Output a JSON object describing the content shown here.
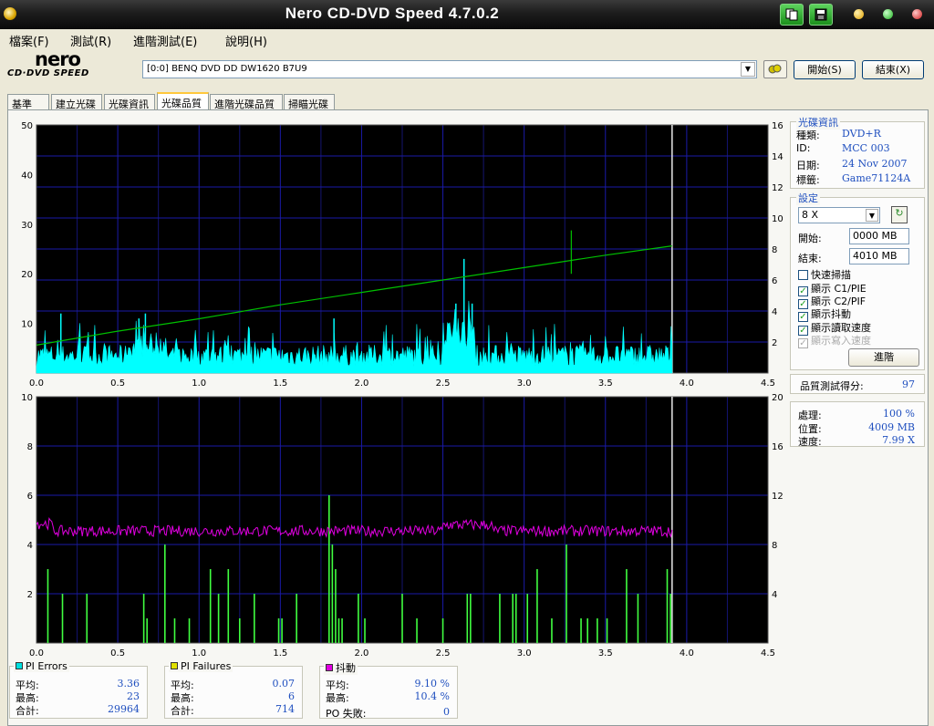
{
  "window": {
    "title": "Nero CD-DVD Speed 4.7.0.2"
  },
  "menu": [
    "檔案(F)",
    "測試(R)",
    "進階測試(E)",
    "說明(H)"
  ],
  "logo": {
    "main": "nero",
    "sub": "CD·DVD SPEED"
  },
  "drive": {
    "selected": "[0:0]  BENQ DVD DD DW1620 B7U9"
  },
  "buttons": {
    "start": "開始(S)",
    "exit": "結束(X)",
    "advanced": "進階"
  },
  "tabs": [
    "基準",
    "建立光碟",
    "光碟資訊",
    "光碟品質",
    "進階光碟品質",
    "掃瞄光碟"
  ],
  "active_tab": 3,
  "disc_info": {
    "title": "光碟資訊",
    "rows": [
      {
        "label": "種類:",
        "value": "DVD+R"
      },
      {
        "label": "ID:",
        "value": "MCC 003"
      },
      {
        "label": "日期:",
        "value": "24 Nov 2007"
      },
      {
        "label": "標籤:",
        "value": "Game71124A"
      }
    ]
  },
  "settings": {
    "title": "設定",
    "speed": "8 X",
    "start_label": "開始:",
    "start_value": "0000 MB",
    "end_label": "結束:",
    "end_value": "4010 MB",
    "checks": [
      {
        "label": "快速掃描",
        "checked": false,
        "disabled": false
      },
      {
        "label": "顯示 C1/PIE",
        "checked": true,
        "disabled": false
      },
      {
        "label": "顯示 C2/PIF",
        "checked": true,
        "disabled": false
      },
      {
        "label": "顯示抖動",
        "checked": true,
        "disabled": false
      },
      {
        "label": "顯示讀取速度",
        "checked": true,
        "disabled": false
      },
      {
        "label": "顯示寫入速度",
        "checked": true,
        "disabled": true
      }
    ]
  },
  "quality": {
    "label": "品質測試得分:",
    "value": "97"
  },
  "progress": {
    "rows": [
      {
        "label": "處理:",
        "value": "100 %"
      },
      {
        "label": "位置:",
        "value": "4009 MB"
      },
      {
        "label": "速度:",
        "value": "7.99 X"
      }
    ]
  },
  "stats": {
    "pi_errors": {
      "title": "PI Errors",
      "color": "#00e0e0",
      "avg_label": "平均:",
      "avg": "3.36",
      "max_label": "最高:",
      "max": "23",
      "total_label": "合計:",
      "total": "29964"
    },
    "pi_failures": {
      "title": "PI Failures",
      "color": "#e0e000",
      "avg_label": "平均:",
      "avg": "0.07",
      "max_label": "最高:",
      "max": "6",
      "total_label": "合計:",
      "total": "714"
    },
    "jitter": {
      "title": "抖動",
      "color": "#e000e0",
      "avg_label": "平均:",
      "avg": "9.10 %",
      "max_label": "最高:",
      "max": "10.4 %",
      "po_label": "PO 失敗:",
      "po": "0"
    }
  },
  "chart_data": [
    {
      "type": "area",
      "x_ticks": [
        "0.0",
        "0.5",
        "1.0",
        "1.5",
        "2.0",
        "2.5",
        "3.0",
        "3.5",
        "4.0",
        "4.5"
      ],
      "y_left_ticks": [
        "10",
        "20",
        "30",
        "40",
        "50"
      ],
      "y_right_ticks": [
        "2",
        "4",
        "6",
        "8",
        "10",
        "12",
        "14",
        "16"
      ],
      "xlim": [
        0,
        4.5
      ],
      "ylim_left": [
        0,
        50
      ],
      "ylim_right": [
        0,
        16
      ],
      "grid": true,
      "end_marker_x": 3.91,
      "series": [
        {
          "name": "PI Errors",
          "color": "#00ffff",
          "axis": "left",
          "avg": 3.36,
          "max": 23,
          "spikes": [
            [
              0.15,
              12
            ],
            [
              0.63,
              11
            ],
            [
              0.67,
              12
            ],
            [
              1.83,
              11
            ],
            [
              2.63,
              23
            ],
            [
              2.58,
              14
            ],
            [
              2.68,
              14
            ]
          ]
        },
        {
          "color": "#00c000",
          "axis": "right",
          "x": [
            0,
            0.5,
            1.0,
            1.5,
            2.0,
            2.5,
            3.0,
            3.5,
            3.91
          ],
          "values": [
            1.8,
            2.7,
            3.5,
            4.4,
            5.2,
            6.0,
            6.8,
            7.6,
            8.2
          ],
          "spikes": [
            [
              3.29,
              9.2
            ],
            [
              3.29,
              6.4
            ]
          ]
        }
      ]
    },
    {
      "type": "bar",
      "x_ticks": [
        "0.0",
        "0.5",
        "1.0",
        "1.5",
        "2.0",
        "2.5",
        "3.0",
        "3.5",
        "4.0",
        "4.5"
      ],
      "y_left_ticks": [
        "2",
        "4",
        "6",
        "8",
        "10"
      ],
      "y_right_ticks": [
        "4",
        "8",
        "12",
        "16",
        "20"
      ],
      "xlim": [
        0,
        4.5
      ],
      "ylim_left": [
        0,
        10
      ],
      "ylim_right": [
        0,
        20
      ],
      "grid": true,
      "end_marker_x": 3.91,
      "series": [
        {
          "name": "PI Failures",
          "color": "#40ff40",
          "axis": "left",
          "bars": [
            [
              0.07,
              3
            ],
            [
              0.16,
              2
            ],
            [
              0.31,
              2
            ],
            [
              0.66,
              2
            ],
            [
              0.68,
              1
            ],
            [
              0.79,
              4
            ],
            [
              0.85,
              1
            ],
            [
              0.94,
              1
            ],
            [
              1.07,
              3
            ],
            [
              1.12,
              2
            ],
            [
              1.18,
              3
            ],
            [
              1.25,
              1
            ],
            [
              1.34,
              2
            ],
            [
              1.49,
              1
            ],
            [
              1.51,
              1
            ],
            [
              1.6,
              2
            ],
            [
              1.8,
              6
            ],
            [
              1.82,
              4
            ],
            [
              1.84,
              3
            ],
            [
              1.86,
              1
            ],
            [
              1.88,
              1
            ],
            [
              1.98,
              2
            ],
            [
              2.02,
              1
            ],
            [
              2.25,
              2
            ],
            [
              2.34,
              1
            ],
            [
              2.5,
              1
            ],
            [
              2.65,
              2
            ],
            [
              2.67,
              2
            ],
            [
              2.85,
              2
            ],
            [
              2.93,
              2
            ],
            [
              2.95,
              2
            ],
            [
              3.02,
              2
            ],
            [
              3.08,
              3
            ],
            [
              3.17,
              1
            ],
            [
              3.26,
              4
            ],
            [
              3.35,
              1
            ],
            [
              3.39,
              1
            ],
            [
              3.45,
              1
            ],
            [
              3.51,
              1
            ],
            [
              3.63,
              3
            ],
            [
              3.7,
              2
            ],
            [
              3.88,
              3
            ],
            [
              3.9,
              2
            ]
          ]
        },
        {
          "name": "抖動",
          "color": "#e000e0",
          "axis": "right",
          "avg": 9.1,
          "max": 10.4
        }
      ]
    }
  ]
}
